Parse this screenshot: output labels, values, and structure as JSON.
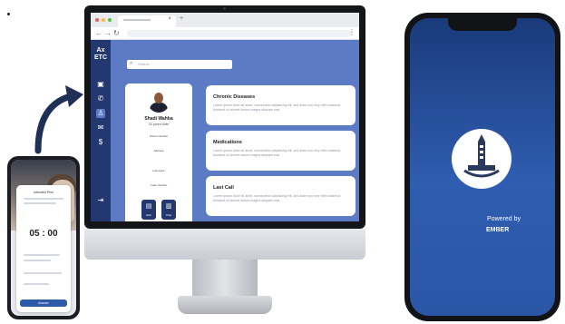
{
  "browser": {
    "tab_title": "",
    "url": ""
  },
  "app": {
    "logo_line1": "Ax",
    "logo_line2": "ETC",
    "search_placeholder": "Search",
    "sidebar_icons": [
      "calendar-icon",
      "phone-icon",
      "user-icon",
      "mail-icon",
      "dollar-icon",
      "logout-icon"
    ],
    "profile": {
      "name": "Shadi Wahba",
      "age": "33 years Male",
      "phone_label": "Phone Number",
      "phone_value": "",
      "address_label": "Address",
      "address_value": "",
      "insurance_label": "Insurance",
      "insurance_value": "",
      "code_label": "Code Number",
      "code_value": "",
      "btn1": "Edit",
      "btn2": "Chat"
    },
    "cards": [
      {
        "title": "Chronic Diseases",
        "body": "Lorem ipsum dolor sit amet, consectetur adipiscing elit, sed diam non nmy nibh euismod tincidunt ut laoreet dolore magna aliquam erat."
      },
      {
        "title": "Medications",
        "body": "Lorem ipsum dolor sit amet, consectetur adipiscing elit, sed diam non nmy nibh euismod tincidunt ut laoreet dolore magna aliquam erat."
      },
      {
        "title": "Last Call",
        "body": "Lorem ipsum dolor sit amet, consectetur adipiscing elit, sed diam non nmy nibh euismod tincidunt ut laoreet dolore magna aliquam erat."
      }
    ]
  },
  "small_phone": {
    "header": "Intended Pers",
    "clock": "05 : 00",
    "button": "Answer"
  },
  "big_phone": {
    "powered_by": "Powered by",
    "brand": "EMBER"
  },
  "colors": {
    "sidebar": "#22386f",
    "app_bg": "#5c7bc4",
    "phone_gradient_top": "#1a3a7a",
    "phone_gradient_bottom": "#2f5db0"
  }
}
